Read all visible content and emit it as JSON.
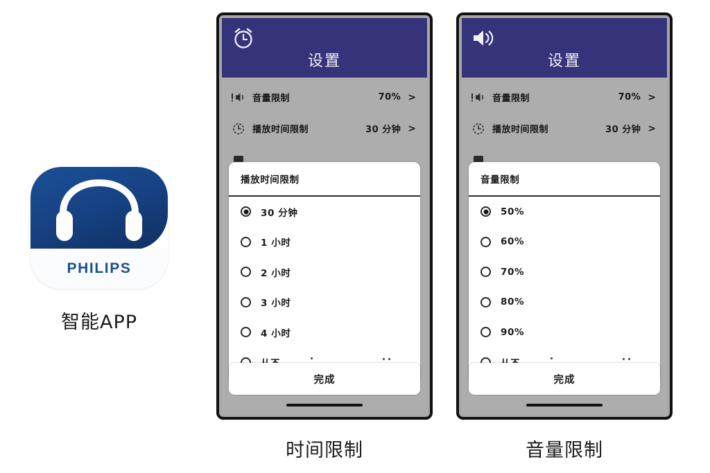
{
  "app": {
    "brand_wordmark": "PHILIPS",
    "caption": "智能APP",
    "icon_name": "headphones-icon",
    "brand_color": "#1b4f96"
  },
  "phones": [
    {
      "id": "time-limit",
      "header": {
        "icon_name": "alarm-clock-icon",
        "title": "设置",
        "bg_color": "#35337a"
      },
      "settings_rows": [
        {
          "icon_name": "volume-limit-icon",
          "label": "音量限制",
          "value": "70%",
          "chevron": ">"
        },
        {
          "icon_name": "timer-icon",
          "label": "播放时间限制",
          "value": "30 分钟",
          "chevron": ">"
        }
      ],
      "modal": {
        "title": "播放时间限制",
        "options": [
          {
            "label": "30 分钟",
            "selected": true
          },
          {
            "label": "1 小时",
            "selected": false
          },
          {
            "label": "2 小时",
            "selected": false
          },
          {
            "label": "3 小时",
            "selected": false
          },
          {
            "label": "4 小时",
            "selected": false
          },
          {
            "label": "从不",
            "selected": false
          }
        ]
      },
      "done_label": "完成",
      "caption": "时间限制"
    },
    {
      "id": "volume-limit",
      "header": {
        "icon_name": "speaker-volume-icon",
        "title": "设置",
        "bg_color": "#35337a"
      },
      "settings_rows": [
        {
          "icon_name": "volume-limit-icon",
          "label": "音量限制",
          "value": "70%",
          "chevron": ">"
        },
        {
          "icon_name": "timer-icon",
          "label": "播放时间限制",
          "value": "30 分钟",
          "chevron": ">"
        }
      ],
      "modal": {
        "title": "音量限制",
        "options": [
          {
            "label": "50%",
            "selected": true
          },
          {
            "label": "60%",
            "selected": false
          },
          {
            "label": "70%",
            "selected": false
          },
          {
            "label": "80%",
            "selected": false
          },
          {
            "label": "90%",
            "selected": false
          },
          {
            "label": "从不",
            "selected": false
          }
        ]
      },
      "done_label": "完成",
      "caption": "音量限制"
    }
  ]
}
